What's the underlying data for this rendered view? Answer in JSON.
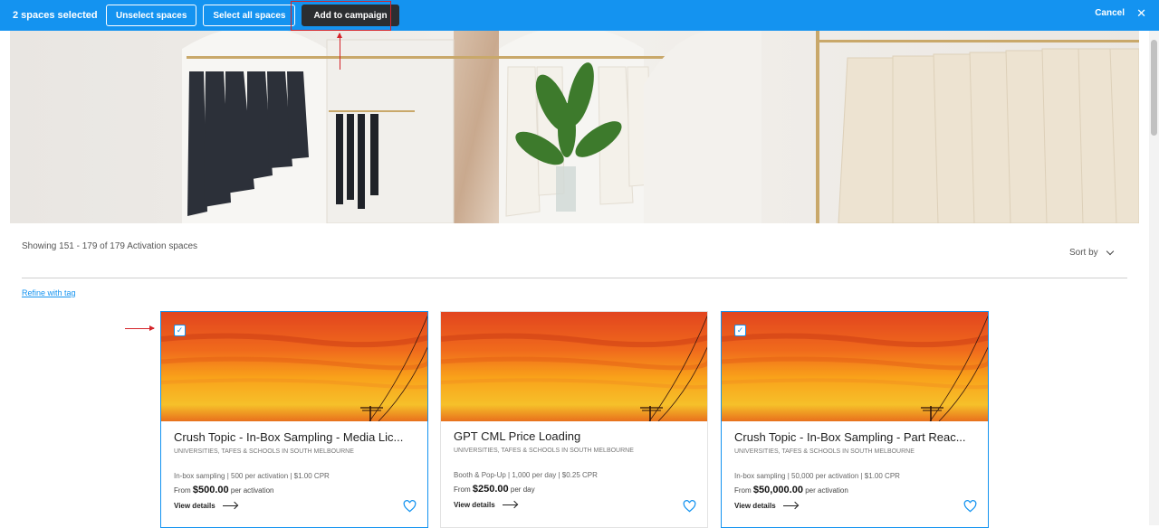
{
  "topbar": {
    "selected_count": "2 spaces selected",
    "unselect_label": "Unselect spaces",
    "select_all_label": "Select all spaces",
    "add_to_campaign_label": "Add to campaign",
    "cancel_label": "Cancel",
    "close_glyph": "✕",
    "bar_color": "#1493f0"
  },
  "results": {
    "showing_text": "Showing 151 - 179 of 179 Activation spaces",
    "sort_label": "Sort by",
    "refine_label": "Refine with tag"
  },
  "cards": [
    {
      "title": "Crush Topic - In-Box Sampling - Media Lic...",
      "category": "UNIVERSITIES, TAFES & SCHOOLS in SOUTH MELBOURNE",
      "meta": "In-box sampling | 500 per activation | $1.00 CPR",
      "price_prefix": "From",
      "price": "$500.00",
      "price_suffix": "per activation",
      "view_label": "View details",
      "selected": true
    },
    {
      "title": "GPT CML Price Loading",
      "category": "UNIVERSITIES, TAFES & SCHOOLS in SOUTH MELBOURNE",
      "meta": "Booth & Pop-Up | 1,000 per day | $0.25 CPR",
      "price_prefix": "From",
      "price": "$250.00",
      "price_suffix": "per day",
      "view_label": "View details",
      "selected": false
    },
    {
      "title": "Crush Topic - In-Box Sampling - Part Reac...",
      "category": "UNIVERSITIES, TAFES & SCHOOLS in SOUTH MELBOURNE",
      "meta": "In-box sampling | 50,000 per activation | $1.00 CPR",
      "price_prefix": "From",
      "price": "$50,000.00",
      "price_suffix": "per activation",
      "view_label": "View details",
      "selected": true
    }
  ],
  "icons": {
    "checkbox": "checkbox-checked-icon",
    "heart": "heart-outline-icon",
    "arrow": "arrow-right-icon",
    "chevron": "chevron-down-icon",
    "close": "close-icon"
  },
  "check_glyph": "✓"
}
